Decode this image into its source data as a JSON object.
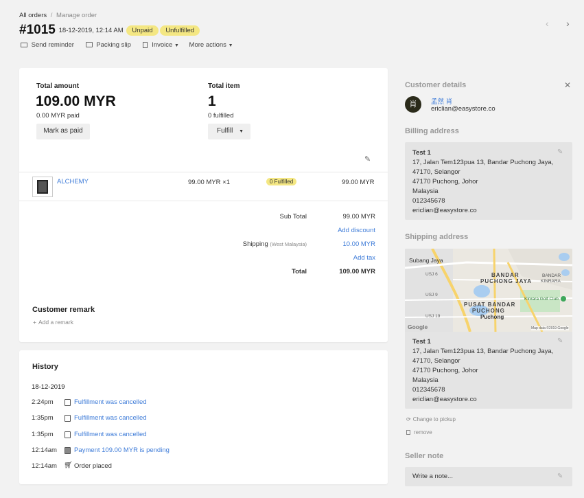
{
  "breadcrumb": {
    "all_orders": "All orders",
    "separator": "/",
    "current": "Manage order"
  },
  "order": {
    "number": "#1015",
    "date": "18-12-2019, 12:14 AM",
    "payment_status": "Unpaid",
    "fulfillment_status": "Unfulfilled"
  },
  "actions": {
    "send_reminder": "Send reminder",
    "packing_slip": "Packing slip",
    "invoice": "Invoice",
    "more_actions": "More actions"
  },
  "summary": {
    "total_amount_label": "Total amount",
    "total_amount": "109.00 MYR",
    "paid": "0.00 MYR paid",
    "mark_paid": "Mark as paid",
    "total_item_label": "Total item",
    "total_item": "1",
    "fulfilled": "0 fulfilled",
    "fulfill": "Fulfill"
  },
  "line_item": {
    "name": "ALCHEMY",
    "price_qty": "99.00 MYR ×1",
    "status": "0 Fulfilled",
    "total": "99.00 MYR"
  },
  "totals": {
    "subtotal_label": "Sub Total",
    "subtotal": "99.00 MYR",
    "add_discount": "Add discount",
    "shipping_label": "Shipping",
    "shipping_region": "(West Malaysia)",
    "shipping": "10.00 MYR",
    "add_tax": "Add tax",
    "total_label": "Total",
    "total": "109.00 MYR"
  },
  "remark": {
    "title": "Customer remark",
    "add": "Add a remark"
  },
  "history": {
    "title": "History",
    "date": "18-12-2019",
    "events": [
      {
        "time": "2:24pm",
        "text": "Fulfillment was cancelled",
        "link": true
      },
      {
        "time": "1:35pm",
        "text": "Fulfillment was cancelled",
        "link": true
      },
      {
        "time": "1:35pm",
        "text": "Fulfillment was cancelled",
        "link": true
      },
      {
        "time": "12:14am",
        "text": "Payment 109.00 MYR is pending",
        "link": true
      },
      {
        "time": "12:14am",
        "text": "Order placed",
        "link": false
      }
    ]
  },
  "customer": {
    "title": "Customer details",
    "avatar": "肖",
    "name": "孟然 肖",
    "email": "ericlian@easystore.co"
  },
  "billing": {
    "title": "Billing address",
    "name": "Test 1",
    "line1": "17, Jalan Tem123pua 13, Bandar Puchong Jaya,",
    "line2": "47170, Selangor",
    "line3": "47170 Puchong, Johor",
    "country": "Malaysia",
    "phone": "012345678",
    "email": "ericlian@easystore.co"
  },
  "shipping": {
    "title": "Shipping address",
    "name": "Test 1",
    "line1": "17, Jalan Tem123pua 13, Bandar Puchong Jaya,",
    "line2": "47170, Selangor",
    "line3": "47170 Puchong, Johor",
    "country": "Malaysia",
    "phone": "012345678",
    "email": "ericlian@easystore.co",
    "change_pickup": "Change to pickup",
    "remove": "remove"
  },
  "map": {
    "labels": {
      "subang": "Subang Jaya",
      "bandar": "BANDAR",
      "puchong_jaya": "PUCHONG JAYA",
      "pusat": "PUSAT BANDAR",
      "puchong1": "PUCHONG",
      "puchong2": "Puchong",
      "bandar_kinrara": "BANDAR",
      "kinrara": "KINRARA",
      "golf": "Kinrara Golf Club",
      "usj6": "USJ 6",
      "usj9": "USJ 9",
      "usj19": "USJ 19",
      "google": "Google",
      "copyright": "Map data ©2019 Google"
    }
  },
  "seller_note": {
    "title": "Seller note",
    "placeholder": "Write a note..."
  }
}
